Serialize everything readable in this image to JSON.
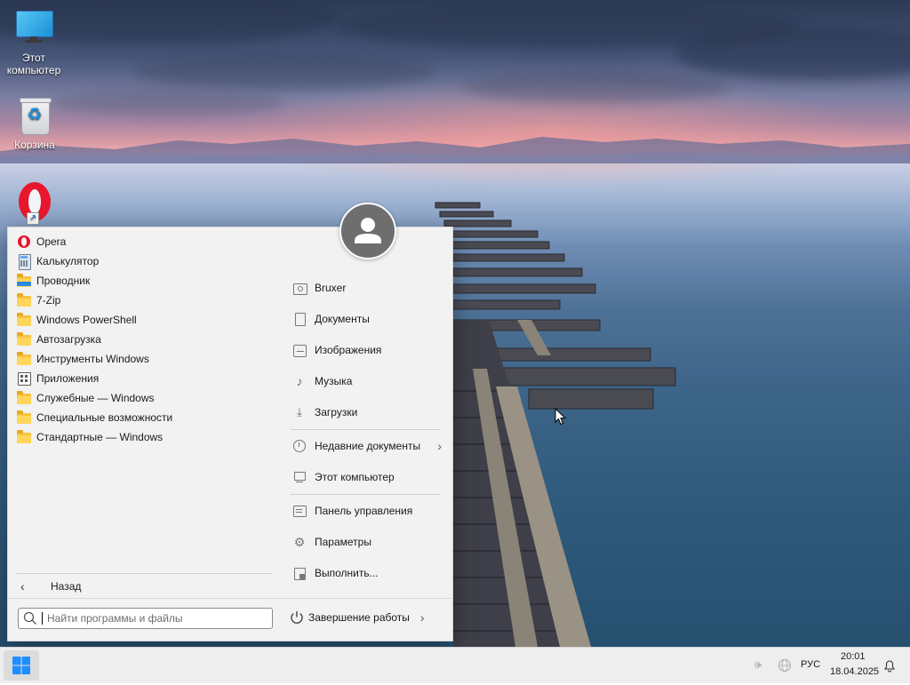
{
  "desktop": {
    "icons": [
      {
        "label": "Этот\nкомпьютер",
        "line1": "Этот",
        "line2": "компьютер",
        "icon": "monitor-icon"
      },
      {
        "label": "Корзина",
        "icon": "recycle-bin-icon"
      },
      {
        "label": "",
        "icon": "opera-icon"
      }
    ]
  },
  "start_menu": {
    "programs": [
      {
        "label": "Opera",
        "icon": "opera-icon"
      },
      {
        "label": "Калькулятор",
        "icon": "calculator-icon"
      },
      {
        "label": "Проводник",
        "icon": "explorer-icon"
      },
      {
        "label": "7-Zip",
        "icon": "folder-icon"
      },
      {
        "label": "Windows PowerShell",
        "icon": "folder-icon"
      },
      {
        "label": "Автозагрузка",
        "icon": "folder-icon"
      },
      {
        "label": "Инструменты Windows",
        "icon": "folder-icon"
      },
      {
        "label": "Приложения",
        "icon": "apps-icon"
      },
      {
        "label": "Служебные — Windows",
        "icon": "folder-icon"
      },
      {
        "label": "Специальные возможности",
        "icon": "folder-icon"
      },
      {
        "label": "Стандартные — Windows",
        "icon": "folder-icon"
      }
    ],
    "back_label": "Назад",
    "search_placeholder": "Найти программы и файлы",
    "right_items": [
      {
        "label": "Bruxer",
        "icon": "user-folder-icon"
      },
      {
        "label": "Документы",
        "icon": "document-icon"
      },
      {
        "label": "Изображения",
        "icon": "image-icon"
      },
      {
        "label": "Музыка",
        "icon": "music-icon"
      },
      {
        "label": "Загрузки",
        "icon": "download-icon"
      },
      {
        "label": "Недавние документы",
        "icon": "recent-icon"
      },
      {
        "label": "Этот компьютер",
        "icon": "computer-icon"
      },
      {
        "label": "Панель управления",
        "icon": "control-panel-icon"
      },
      {
        "label": "Параметры",
        "icon": "settings-icon"
      },
      {
        "label": "Выполнить...",
        "icon": "run-icon"
      }
    ],
    "shutdown_label": "Завершение работы"
  },
  "taskbar": {
    "language": "РУС",
    "time": "20:01",
    "date": "18.04.2025"
  }
}
